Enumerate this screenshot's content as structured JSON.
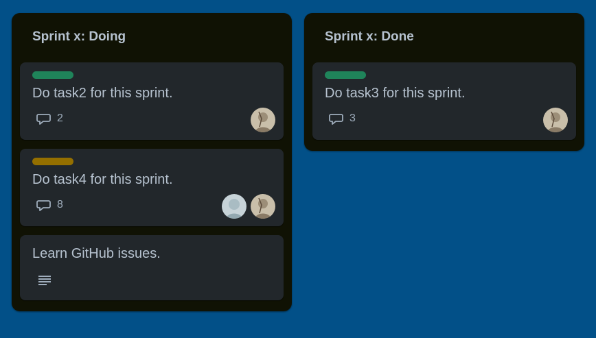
{
  "colors": {
    "board_background": "#025088",
    "list_background": "#101204",
    "card_background": "#22272b",
    "label_green": "#1f845a",
    "label_yellow": "#946f00",
    "text": "#b6c2cf",
    "muted_text": "#9fadbc"
  },
  "lists": [
    {
      "title": "Sprint x: Doing",
      "cards": [
        {
          "label_color": "green",
          "title": "Do task2 for this sprint.",
          "comment_count": "2",
          "avatars": [
            "sketch-portrait-avatar"
          ]
        },
        {
          "label_color": "yellow",
          "title": "Do task4 for this sprint.",
          "comment_count": "8",
          "avatars": [
            "light-sketch-avatar",
            "sketch-portrait-avatar"
          ]
        },
        {
          "label_color": null,
          "title": "Learn GitHub issues.",
          "badge_icon": "description-icon"
        }
      ]
    },
    {
      "title": "Sprint x: Done",
      "cards": [
        {
          "label_color": "green",
          "title": "Do task3 for this sprint.",
          "comment_count": "3",
          "avatars": [
            "sketch-portrait-avatar"
          ]
        }
      ]
    }
  ]
}
